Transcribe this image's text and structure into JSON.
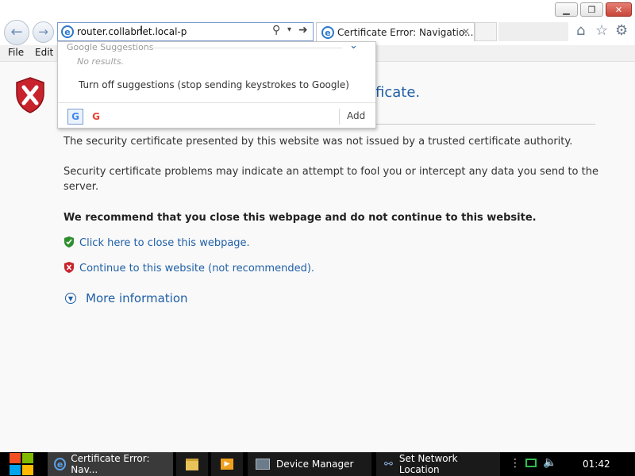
{
  "browser": {
    "address": {
      "url": "router.collabnet.local-p"
    },
    "tab": {
      "title": "Certificate Error: Navigatio..."
    }
  },
  "menu": {
    "items": [
      "File",
      "Edit"
    ]
  },
  "suggestions": {
    "header": "Google Suggestions",
    "no_results": "No results.",
    "turn_off": "Turn off suggestions (stop sending keystrokes to Google)",
    "add": "Add",
    "provider_letter": "G"
  },
  "page": {
    "heading_tail": "ificate.",
    "para1": "The security certificate presented by this website was not issued by a trusted certificate authority.",
    "para2": "Security certificate problems may indicate an attempt to fool you or intercept any data you send to the server.",
    "recommend": "We recommend that you close this webpage and do not continue to this website.",
    "close_link": "Click here to close this webpage.",
    "continue_link": "Continue to this website (not recommended).",
    "more_info": "More information"
  },
  "taskbar": {
    "items": [
      {
        "label": "Certificate Error: Nav..."
      },
      {
        "label": ""
      },
      {
        "label": ""
      },
      {
        "label": "Device Manager"
      },
      {
        "label": "Set Network Location"
      }
    ],
    "clock": "01:42"
  },
  "colors": {
    "accent": "#1f5fa6",
    "shield_red": "#c8232c",
    "shield_green": "#2f8f2f",
    "address_border": "#7a9cd3"
  }
}
